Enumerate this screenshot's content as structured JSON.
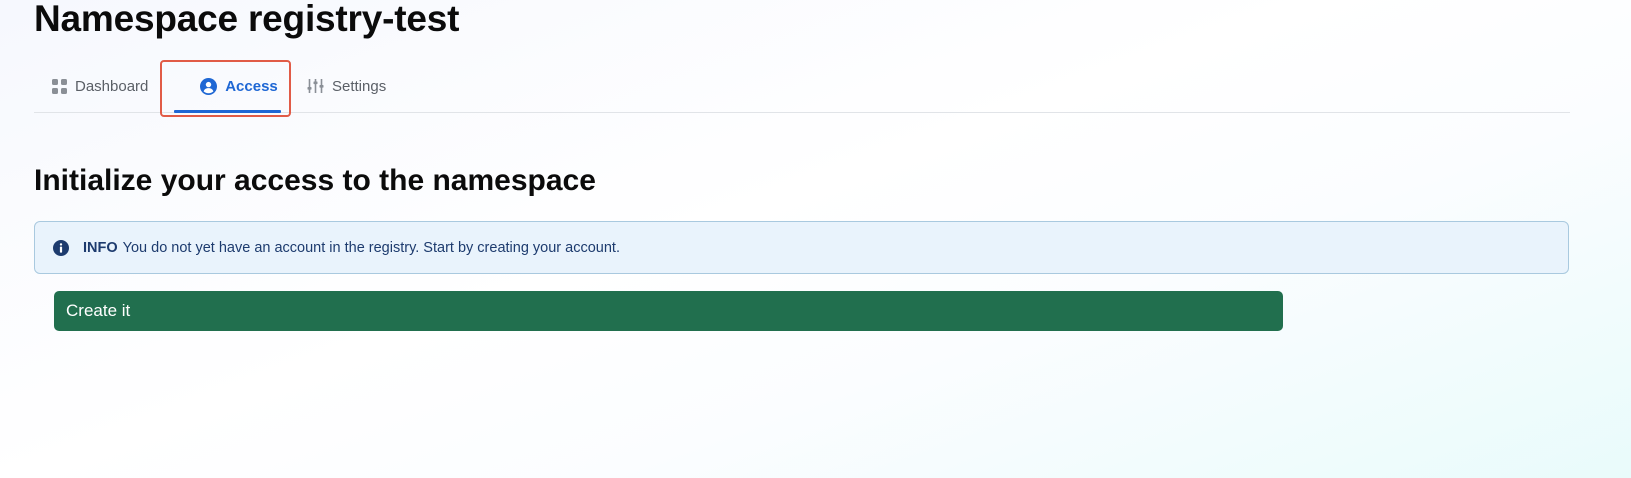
{
  "page": {
    "title": "Namespace registry-test"
  },
  "tabs": [
    {
      "label": "Dashboard",
      "icon": "dashboard-grid-icon",
      "active": false
    },
    {
      "label": "Access",
      "icon": "user-circle-icon",
      "active": true
    },
    {
      "label": "Settings",
      "icon": "sliders-icon",
      "active": false
    }
  ],
  "section": {
    "heading": "Initialize your access to the namespace"
  },
  "info": {
    "icon": "info-icon",
    "tag": "INFO",
    "message": "You do not yet have an account in the registry. Start by creating your account."
  },
  "actions": {
    "create_label": "Create it"
  },
  "colors": {
    "accent": "#1f67d4",
    "highlight": "#e15b47",
    "primary_button": "#216f4e",
    "info_background": "#e9f3fc",
    "info_border": "#a9c9df",
    "info_text": "#1d3b6e"
  }
}
